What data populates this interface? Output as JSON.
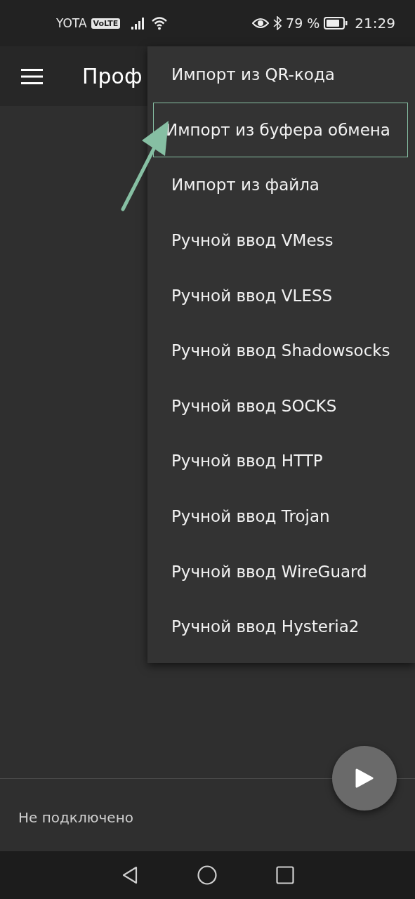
{
  "status_bar": {
    "carrier": "YOTA",
    "network_badge": "VoLTE",
    "battery_percent": "79 %",
    "time": "21:29"
  },
  "app_bar": {
    "title": "Проф"
  },
  "menu": {
    "items": [
      {
        "label": "Импорт из QR-кода",
        "highlighted": false
      },
      {
        "label": "Импорт из буфера обмена",
        "highlighted": true
      },
      {
        "label": "Импорт из файла",
        "highlighted": false
      },
      {
        "label": "Ручной ввод VMess",
        "highlighted": false
      },
      {
        "label": "Ручной ввод VLESS",
        "highlighted": false
      },
      {
        "label": "Ручной ввод Shadowsocks",
        "highlighted": false
      },
      {
        "label": "Ручной ввод SOCKS",
        "highlighted": false
      },
      {
        "label": "Ручной ввод HTTP",
        "highlighted": false
      },
      {
        "label": "Ручной ввод Trojan",
        "highlighted": false
      },
      {
        "label": "Ручной ввод WireGuard",
        "highlighted": false
      },
      {
        "label": "Ручной ввод Hysteria2",
        "highlighted": false
      }
    ]
  },
  "footer": {
    "status": "Не подключено"
  }
}
